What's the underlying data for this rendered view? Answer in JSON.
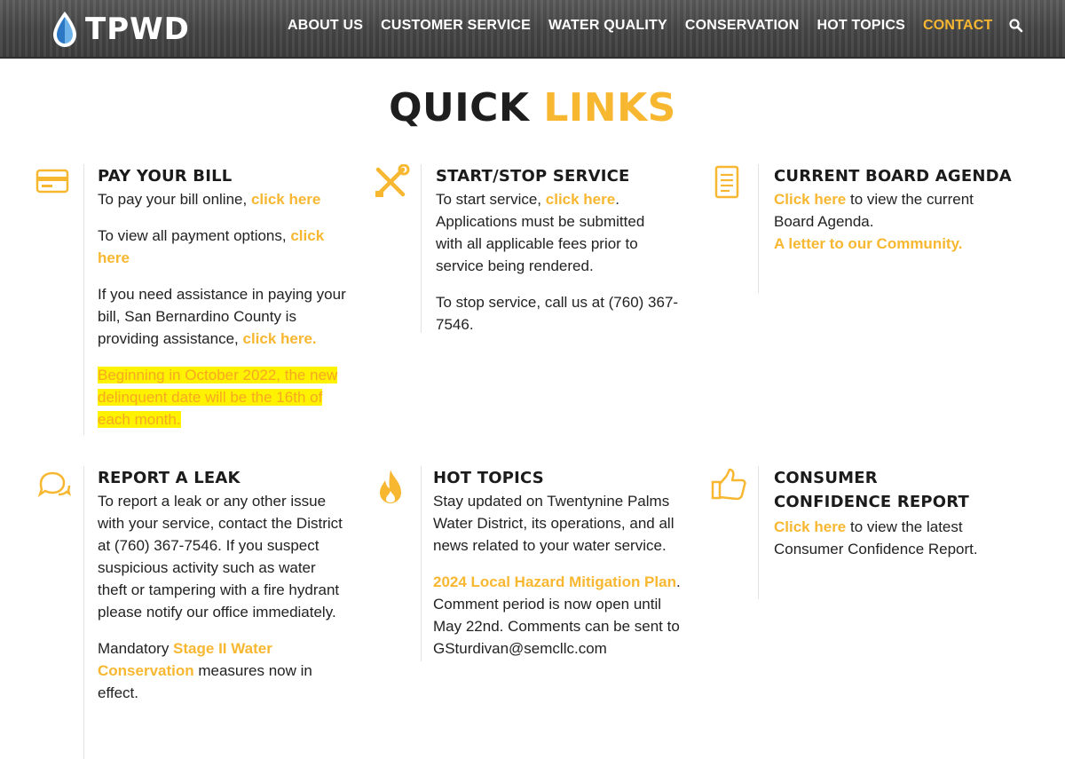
{
  "brand": {
    "name": "TPWD"
  },
  "nav": {
    "items": [
      "ABOUT US",
      "CUSTOMER SERVICE",
      "WATER QUALITY",
      "CONSERVATION",
      "HOT TOPICS",
      "CONTACT"
    ],
    "active": "CONTACT"
  },
  "title": {
    "part1": "QUICK",
    "part2": "LINKS"
  },
  "colors": {
    "accent": "#f7b731",
    "highlight": "#fff200",
    "dark": "#1e1e1e"
  },
  "cards": {
    "pay": {
      "heading": "PAY YOUR BILL",
      "p1_text": "To pay your bill online, ",
      "p1_link": "click here",
      "p2_text": "To view all payment options, ",
      "p2_link": "click here",
      "p3_text": "If you need assistance in paying your bill, San Bernardino County is providing assistance, ",
      "p3_link": "click here.",
      "notice": "Beginning in October 2022, the new delinquent date will be the 16th of each month."
    },
    "service": {
      "heading": "START/STOP SERVICE",
      "p1_text": "To start service, ",
      "p1_link": "click here",
      "p1_after": ". Applications must be submitted with all applicable fees prior to service being rendered.",
      "p2_text": "To stop service, call us at (760) 367-7546."
    },
    "agenda": {
      "heading": "CURRENT BOARD AGENDA",
      "p1_link": "Click here",
      "p1_after": " to view the current Board Agenda.",
      "p2_link": "A letter to our Community."
    },
    "leak": {
      "heading": "REPORT A LEAK",
      "p1_text": "To report a leak or any other issue with your service, contact the District at (760) 367-7546. If you suspect suspicious activity such as water theft or tampering with a fire hydrant please notify our office immediately.",
      "p2_text": "Mandatory ",
      "p2_link": "Stage II Water Conservation",
      "p2_after": " measures now in effect."
    },
    "topics": {
      "heading": "HOT TOPICS",
      "p1_text": "Stay updated on Twentynine Palms Water District, its operations, and all news related to your water service.",
      "p2_link": "2024 Local Hazard Mitigation Plan",
      "p2_after": ". Comment period is now open until May 22nd. Comments can be sent to GSturdivan@semcllc.com"
    },
    "ccr": {
      "heading": "CONSUMER CONFIDENCE REPORT",
      "p1_link": "Click here",
      "p1_after": " to view the latest Consumer Confidence Report."
    }
  }
}
